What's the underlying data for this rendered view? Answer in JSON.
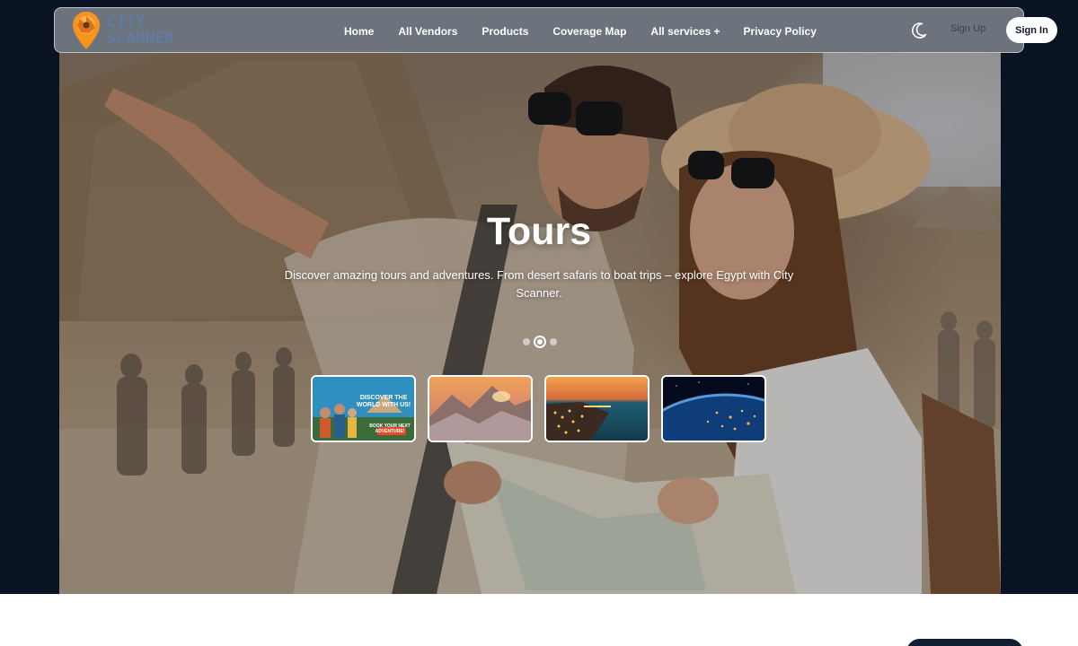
{
  "brand": {
    "line1": "CITY",
    "line2": "SCANNER",
    "logo_icon": "location-pin-camera-aperture-icon",
    "accent": "#f7941d"
  },
  "nav": {
    "links": [
      "Home",
      "All Vendors",
      "Products",
      "Coverage Map",
      "All services +",
      "Privacy Policy"
    ],
    "theme_icon": "moon-icon",
    "signup_label": "Sign Up",
    "signin_label": "Sign In"
  },
  "hero": {
    "title": "Tours",
    "description": "Discover amazing tours and adventures. From desert safaris to boat trips – explore Egypt with City Scanner.",
    "slides_total": 3,
    "active_slide": 2,
    "thumbnails": [
      {
        "name": "thumb-tour-poster",
        "caption": "DISCOVER THE WORLD WITH US!",
        "sub": "BOOK YOUR NEXT ADVENTURE!"
      },
      {
        "name": "thumb-mountain-sunset"
      },
      {
        "name": "thumb-coastal-city-night"
      },
      {
        "name": "thumb-earth-from-space"
      }
    ]
  },
  "colors": {
    "page_dark": "#0a1322",
    "navbar": "#767c86",
    "signin_bg": "#ffffff"
  }
}
